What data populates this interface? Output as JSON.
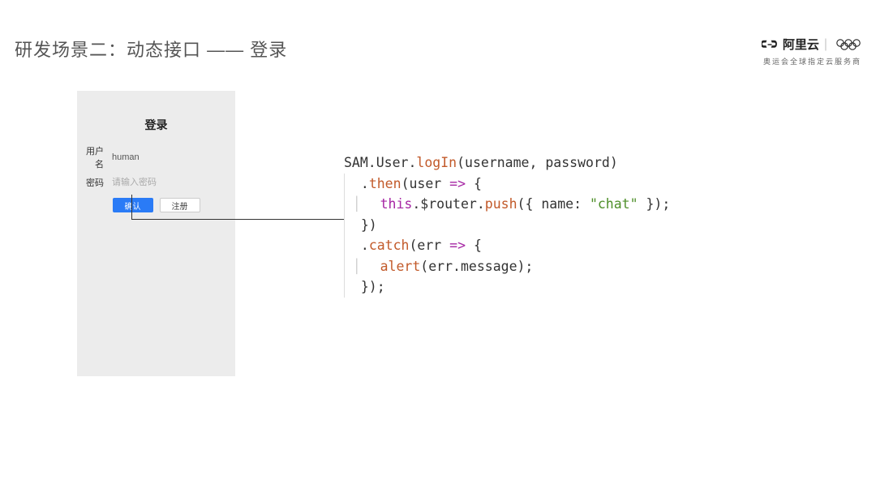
{
  "header": {
    "title": "研发场景二：动态接口 —— 登录",
    "brand_name": "阿里云",
    "brand_sub": "奥运会全球指定云服务商"
  },
  "login": {
    "title": "登录",
    "username_label": "用户名",
    "username_value": "human",
    "password_label": "密码",
    "password_placeholder": "请输入密码",
    "confirm_label": "确认",
    "register_label": "注册"
  },
  "code": {
    "line1_a": "SAM.User.",
    "line1_b": "logIn",
    "line1_c": "(username, password)",
    "line2_a": "  .",
    "line2_b": "then",
    "line2_c": "(user ",
    "line2_d": "=>",
    "line2_e": " {",
    "line3_a": "    ",
    "line3_b": "this",
    "line3_c": ".$router.",
    "line3_d": "push",
    "line3_e": "({ name: ",
    "line3_f": "\"chat\"",
    "line3_g": " });",
    "line4": "  })",
    "line5_a": "  .",
    "line5_b": "catch",
    "line5_c": "(err ",
    "line5_d": "=>",
    "line5_e": " {",
    "line6_a": "    ",
    "line6_b": "alert",
    "line6_c": "(err.message);",
    "line7": "  });"
  }
}
